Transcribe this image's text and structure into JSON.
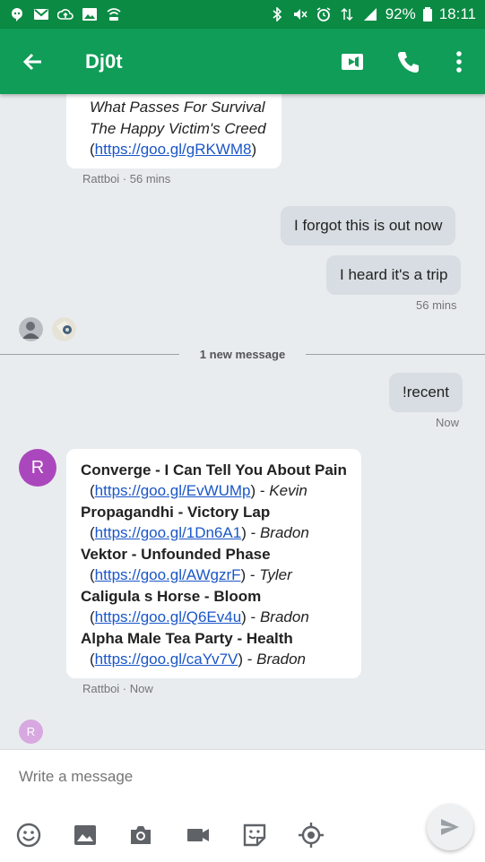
{
  "status_bar": {
    "battery": "92%",
    "time": "18:11"
  },
  "header": {
    "title": "Dj0t"
  },
  "colors": {
    "status_bar": "#0a8a43",
    "app_bar": "#0f9d58",
    "link": "#1a56c8",
    "avatar": "#ab47bc"
  },
  "conversation": {
    "first_message": {
      "line1": "What Passes For Survival",
      "line2": "The Happy Victim's Creed",
      "open": "(",
      "link": "https://goo.gl/gRKWM8",
      "close": ")",
      "meta": "Rattboi · 56 mins"
    },
    "outgoing": [
      {
        "text": "I forgot this is out now"
      },
      {
        "text": "I heard it's a trip"
      }
    ],
    "outgoing_meta": "56 mins",
    "new_message_divider": "1 new message",
    "recent": {
      "text": "!recent",
      "meta": "Now"
    },
    "recent_list": {
      "avatar_letter": "R",
      "items": [
        {
          "title": "Converge - I Can Tell You About Pain",
          "open": "(",
          "link": "https://goo.gl/EvWUMp",
          "close": ") -",
          "by": "Kevin"
        },
        {
          "title": "Propagandhi - Victory Lap",
          "open": "(",
          "link": "https://goo.gl/1Dn6A1",
          "close": ") -",
          "by": "Bradon"
        },
        {
          "title": "Vektor - Unfounded Phase",
          "open": "(",
          "link": "https://goo.gl/AWgzrF",
          "close": ") -",
          "by": "Tyler"
        },
        {
          "title": "Caligula s Horse - Bloom",
          "open": "(",
          "link": "https://goo.gl/Q6Ev4u",
          "close": ") -",
          "by": "Bradon"
        },
        {
          "title": "Alpha Male Tea Party - Health",
          "open": "(",
          "link": "https://goo.gl/caYv7V",
          "close": ") -",
          "by": "Bradon"
        }
      ],
      "meta": "Rattboi · Now"
    },
    "typing_avatar_letter": "R"
  },
  "compose": {
    "placeholder": "Write a message"
  }
}
